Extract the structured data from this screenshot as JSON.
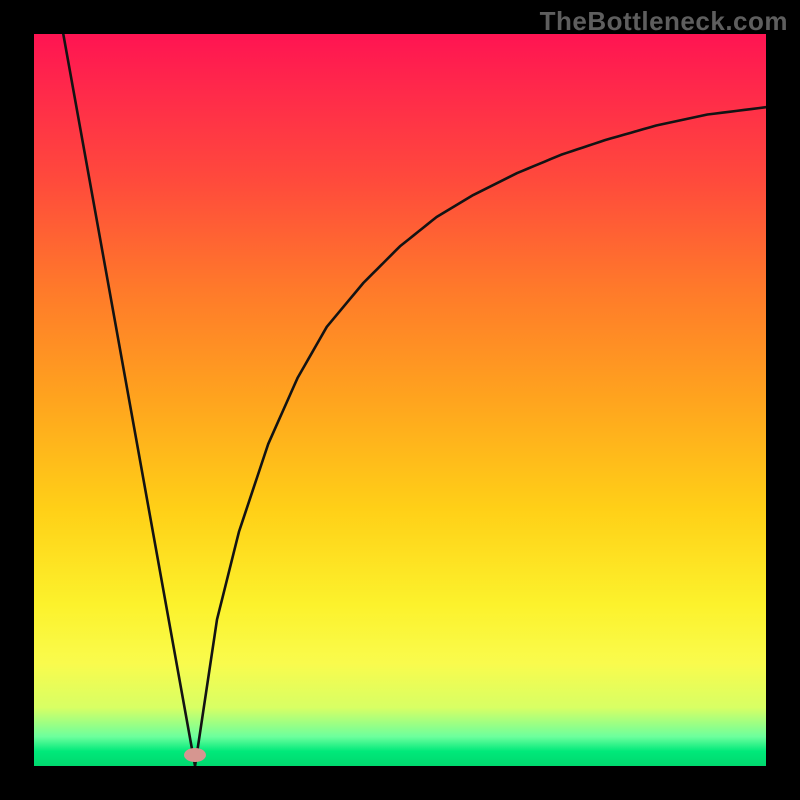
{
  "watermark": "TheBottleneck.com",
  "chart_data": {
    "type": "line",
    "title": "",
    "xlabel": "",
    "ylabel": "",
    "xlim": [
      0,
      100
    ],
    "ylim": [
      0,
      100
    ],
    "series": [
      {
        "name": "left-line",
        "x": [
          4,
          22
        ],
        "y": [
          100,
          0
        ]
      },
      {
        "name": "right-curve",
        "x": [
          22,
          25,
          28,
          32,
          36,
          40,
          45,
          50,
          55,
          60,
          66,
          72,
          78,
          85,
          92,
          100
        ],
        "y": [
          0,
          20,
          32,
          44,
          53,
          60,
          66,
          71,
          75,
          78,
          81,
          83.5,
          85.5,
          87.5,
          89,
          90
        ]
      }
    ],
    "marker": {
      "x": 22,
      "y": 1.5,
      "color": "#d69690"
    },
    "gradient": {
      "top": "#ff1452",
      "middle": "#ffc81a",
      "bottom": "#00d86e"
    },
    "grid": false,
    "legend": false
  }
}
